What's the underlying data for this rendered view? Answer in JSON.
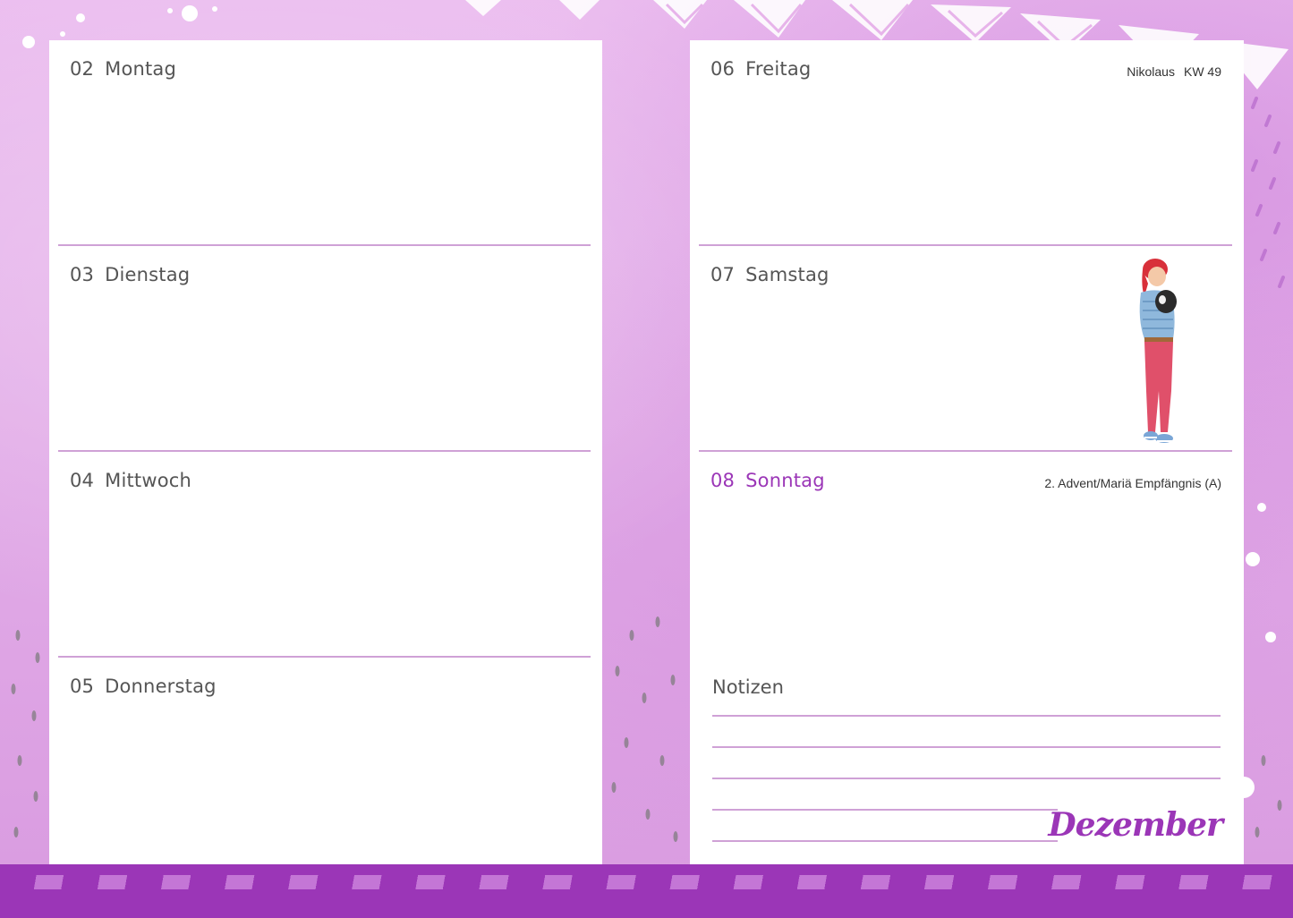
{
  "left_page": {
    "days": [
      {
        "num": "02",
        "name": "Montag"
      },
      {
        "num": "03",
        "name": "Dienstag"
      },
      {
        "num": "04",
        "name": "Mittwoch"
      },
      {
        "num": "05",
        "name": "Donnerstag"
      }
    ]
  },
  "right_page": {
    "days": [
      {
        "num": "06",
        "name": "Freitag",
        "note": "Nikolaus",
        "week": "KW 49"
      },
      {
        "num": "07",
        "name": "Samstag"
      },
      {
        "num": "08",
        "name": "Sonntag",
        "note": "2. Advent/Mariä Empfängnis (A)"
      }
    ],
    "notes_title": "Notizen",
    "month": "Dezember"
  },
  "colors": {
    "accent": "#9b36b7",
    "background": "#e7b4ea",
    "rule": "#cfa1d6",
    "text": "#555555"
  },
  "icons": [
    "girl-with-dog-illustration"
  ]
}
